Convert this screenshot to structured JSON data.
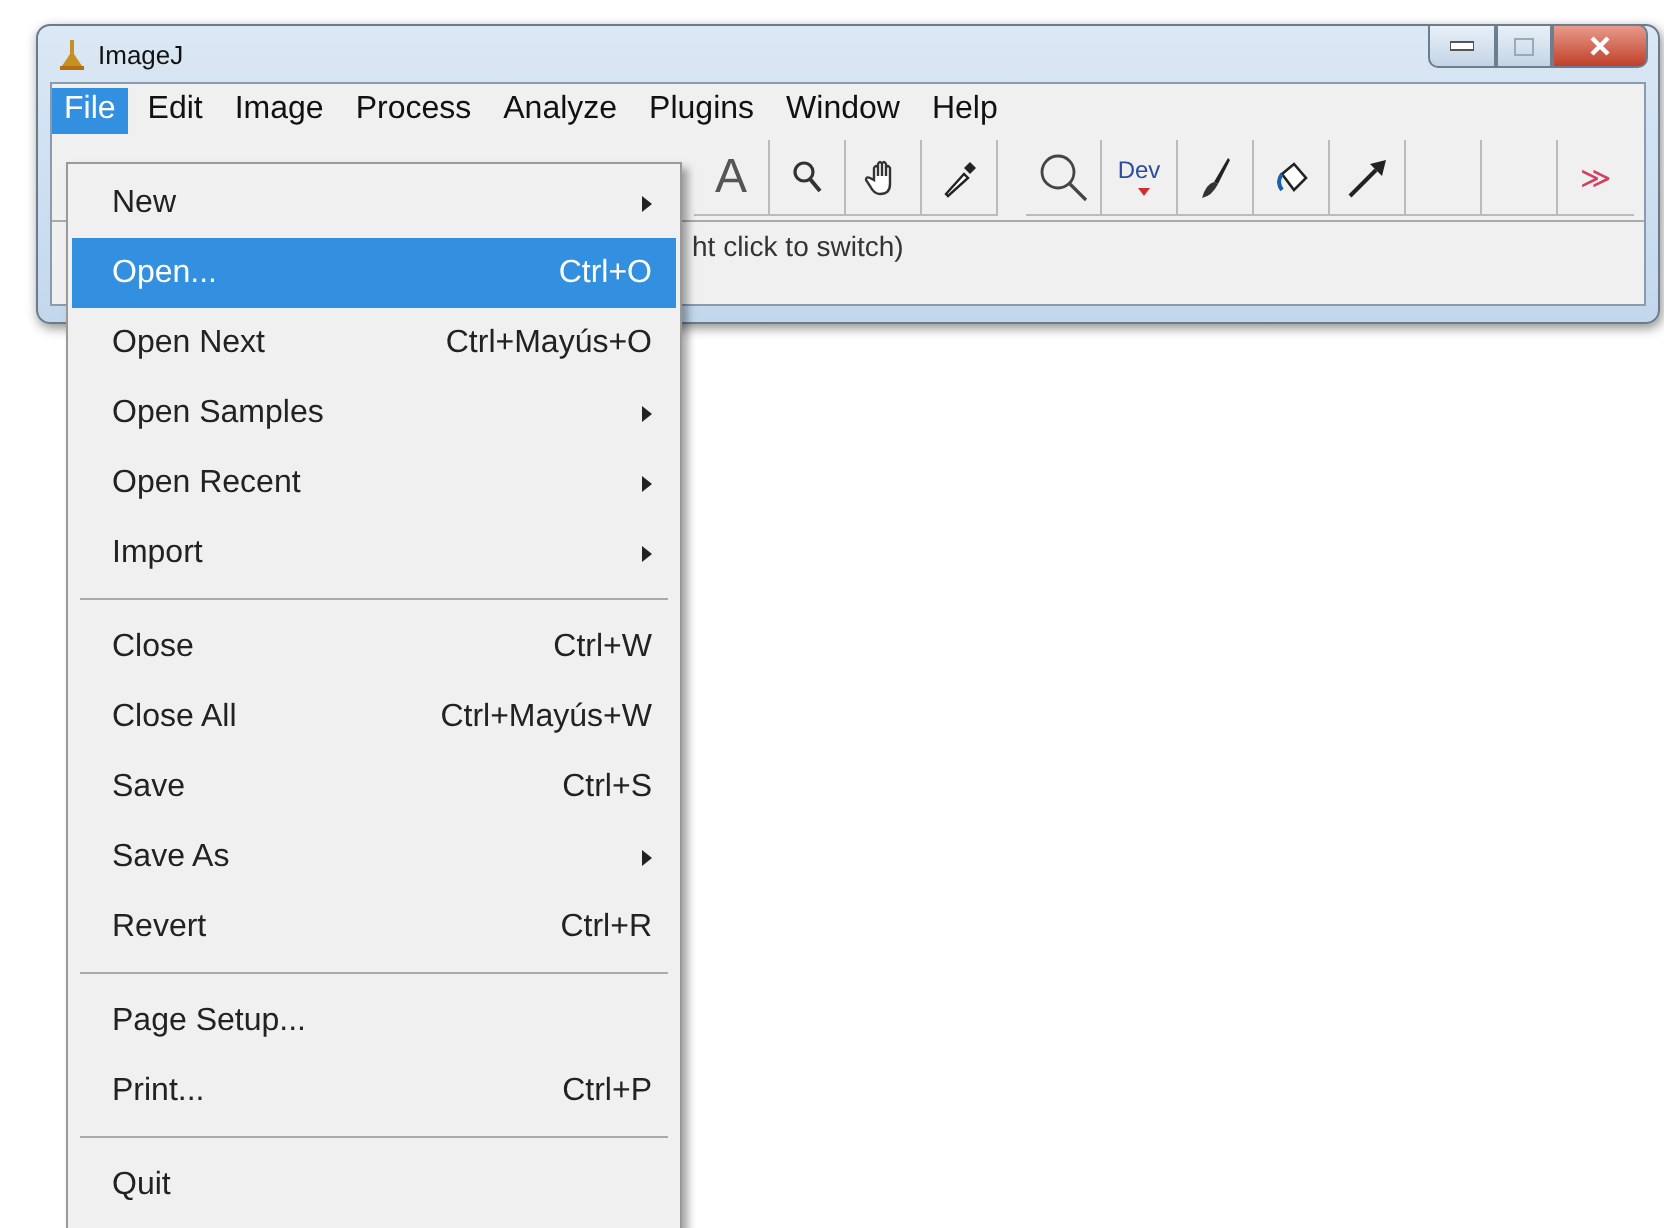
{
  "window": {
    "title": "ImageJ"
  },
  "menubar": [
    {
      "label": "File",
      "selected": true
    },
    {
      "label": "Edit",
      "selected": false
    },
    {
      "label": "Image",
      "selected": false
    },
    {
      "label": "Process",
      "selected": false
    },
    {
      "label": "Analyze",
      "selected": false
    },
    {
      "label": "Plugins",
      "selected": false
    },
    {
      "label": "Window",
      "selected": false
    },
    {
      "label": "Help",
      "selected": false
    }
  ],
  "toolbar": [
    {
      "kind": "text",
      "label": "A"
    },
    {
      "kind": "icon"
    },
    {
      "kind": "icon"
    },
    {
      "kind": "icon"
    },
    {
      "kind": "gap"
    },
    {
      "kind": "icon"
    },
    {
      "kind": "dev",
      "label": "Dev"
    },
    {
      "kind": "icon"
    },
    {
      "kind": "icon"
    },
    {
      "kind": "icon"
    },
    {
      "kind": "empty"
    },
    {
      "kind": "empty"
    },
    {
      "kind": "more",
      "label": "≫"
    }
  ],
  "status_bar": "ht click to switch)",
  "file_menu": [
    {
      "kind": "item",
      "label": "New",
      "submenu": true,
      "selected": false
    },
    {
      "kind": "item",
      "label": "Open...",
      "shortcut": "Ctrl+O",
      "submenu": false,
      "selected": true
    },
    {
      "kind": "item",
      "label": "Open Next",
      "shortcut": "Ctrl+Mayús+O",
      "submenu": false,
      "selected": false
    },
    {
      "kind": "item",
      "label": "Open Samples",
      "submenu": true,
      "selected": false
    },
    {
      "kind": "item",
      "label": "Open Recent",
      "submenu": true,
      "selected": false
    },
    {
      "kind": "item",
      "label": "Import",
      "submenu": true,
      "selected": false
    },
    {
      "kind": "separator"
    },
    {
      "kind": "item",
      "label": "Close",
      "shortcut": "Ctrl+W",
      "submenu": false,
      "selected": false
    },
    {
      "kind": "item",
      "label": "Close All",
      "shortcut": "Ctrl+Mayús+W",
      "submenu": false,
      "selected": false
    },
    {
      "kind": "item",
      "label": "Save",
      "shortcut": "Ctrl+S",
      "submenu": false,
      "selected": false
    },
    {
      "kind": "item",
      "label": "Save As",
      "submenu": true,
      "selected": false
    },
    {
      "kind": "item",
      "label": "Revert",
      "shortcut": "Ctrl+R",
      "submenu": false,
      "selected": false
    },
    {
      "kind": "separator"
    },
    {
      "kind": "item",
      "label": "Page Setup...",
      "submenu": false,
      "selected": false
    },
    {
      "kind": "item",
      "label": "Print...",
      "shortcut": "Ctrl+P",
      "submenu": false,
      "selected": false
    },
    {
      "kind": "separator"
    },
    {
      "kind": "item",
      "label": "Quit",
      "submenu": false,
      "selected": false
    }
  ]
}
